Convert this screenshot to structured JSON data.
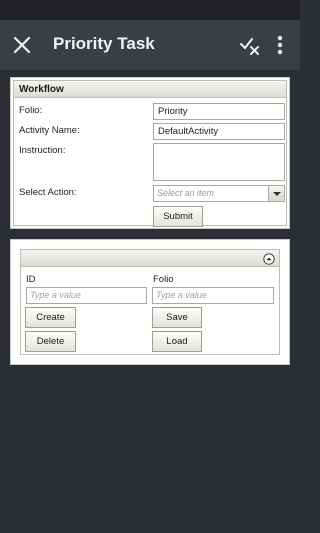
{
  "app_bar": {
    "title": "Priority Task",
    "close_icon": "close-icon",
    "check_icon": "check-cancel-icon",
    "menu_icon": "more-vert-icon"
  },
  "workflow": {
    "header": "Workflow",
    "folio_label": "Folio:",
    "folio_value": "Priority",
    "activity_label": "Activity Name:",
    "activity_value": "DefaultActivity",
    "instruction_label": "Instruction:",
    "instruction_value": "",
    "select_action_label": "Select Action:",
    "select_action_placeholder": "Select an item",
    "submit_label": "Submit"
  },
  "grid": {
    "id_label": "ID",
    "id_placeholder": "Type a value",
    "folio_label": "Folio",
    "folio_placeholder": "Type a value",
    "create_label": "Create",
    "save_label": "Save",
    "delete_label": "Delete",
    "load_label": "Load"
  },
  "colors": {
    "background": "#2b2f33",
    "app_bar": "#3c3f42",
    "panel": "#ffffff"
  }
}
